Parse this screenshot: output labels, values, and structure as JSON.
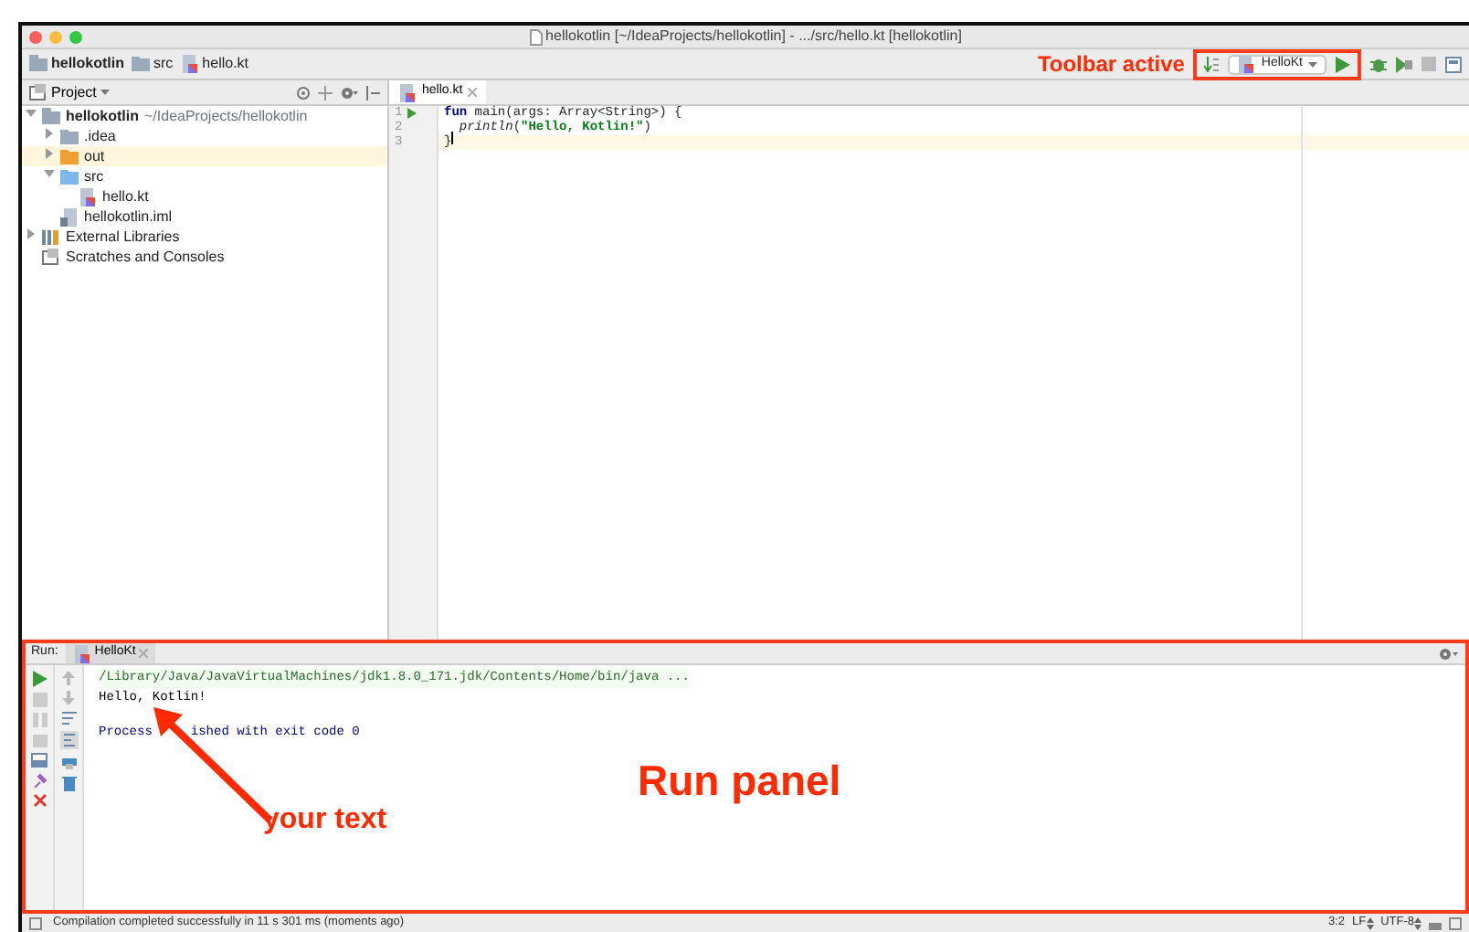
{
  "window": {
    "title": "hellokotlin [~/IdeaProjects/hellokotlin] - .../src/hello.kt [hellokotlin]"
  },
  "breadcrumbs": [
    {
      "label": "hellokotlin",
      "kind": "module"
    },
    {
      "label": "src",
      "kind": "folder"
    },
    {
      "label": "hello.kt",
      "kind": "kotlin"
    }
  ],
  "toolbar": {
    "run_config": "HelloKt",
    "callout": "Toolbar active"
  },
  "project_panel": {
    "title": "Project",
    "tree": [
      {
        "label": "hellokotlin",
        "path": "~/IdeaProjects/hellokotlin",
        "kind": "module",
        "expanded": true,
        "selected": false,
        "children": [
          {
            "label": ".idea",
            "kind": "folder",
            "expanded": false,
            "selected": false
          },
          {
            "label": "out",
            "kind": "excluded",
            "expanded": false,
            "selected": true
          },
          {
            "label": "src",
            "kind": "source",
            "expanded": true,
            "selected": false,
            "children": [
              {
                "label": "hello.kt",
                "kind": "kotlin",
                "selected": false
              }
            ]
          },
          {
            "label": "hellokotlin.iml",
            "kind": "iml",
            "selected": false
          }
        ]
      },
      {
        "label": "External Libraries",
        "kind": "libraries",
        "expanded": false,
        "selected": false
      },
      {
        "label": "Scratches and Consoles",
        "kind": "scratches",
        "selected": false
      }
    ]
  },
  "editor": {
    "tabs": [
      {
        "label": "hello.kt",
        "selected": true
      }
    ],
    "lines": [
      {
        "number": "1",
        "run_marker": true,
        "current": false,
        "tokens": [
          {
            "text": "fun",
            "kind": "keyword"
          },
          {
            "text": " main(args: Array<String>) {",
            "kind": "plain"
          }
        ]
      },
      {
        "number": "2",
        "run_marker": false,
        "current": false,
        "tokens": [
          {
            "text": "  println",
            "kind": "call"
          },
          {
            "text": "(",
            "kind": "plain"
          },
          {
            "text": "\"Hello, Kotlin!\"",
            "kind": "string"
          },
          {
            "text": ")",
            "kind": "plain"
          }
        ]
      },
      {
        "number": "3",
        "run_marker": false,
        "current": true,
        "tokens": [
          {
            "text": "}",
            "kind": "plain"
          }
        ]
      }
    ]
  },
  "run_panel": {
    "label": "Run:",
    "tabs": [
      {
        "label": "HelloKt",
        "selected": true
      }
    ],
    "console": [
      {
        "text": "/Library/Java/JavaVirtualMachines/jdk1.8.0_171.jdk/Contents/Home/bin/java ...",
        "kind": "command"
      },
      {
        "text": "Hello, Kotlin!",
        "kind": "output"
      },
      {
        "segments": [
          "Process",
          "ished with exit code 0"
        ],
        "kind": "system"
      }
    ],
    "callout": "Run panel",
    "arrow_callout": "your text"
  },
  "status_bar": {
    "message": "Compilation completed successfully in 11 s 301 ms (moments ago)",
    "position": "3:2",
    "line_separator": "LF",
    "encoding": "UTF-8"
  }
}
